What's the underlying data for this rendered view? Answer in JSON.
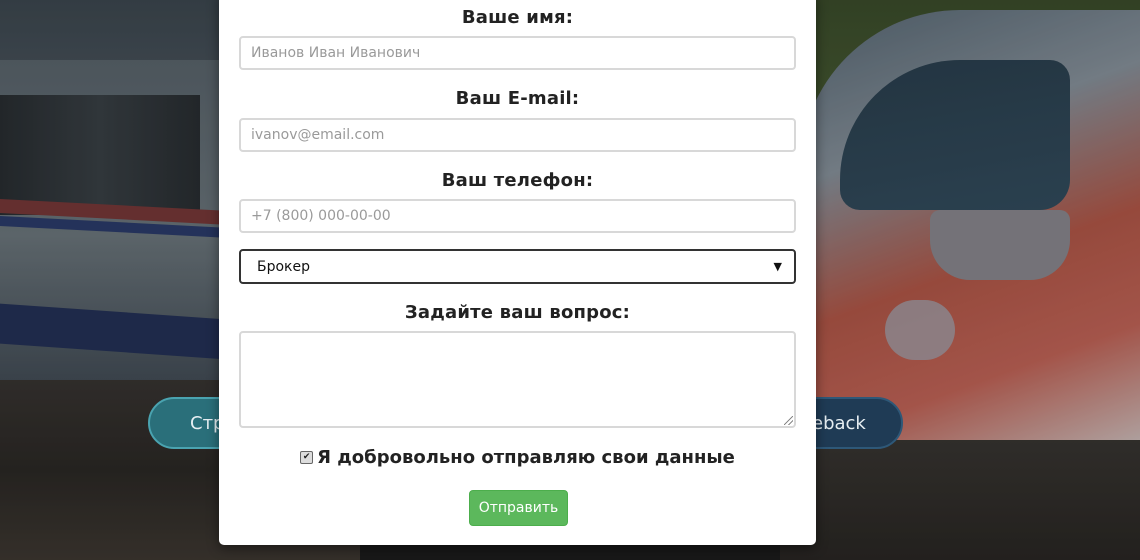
{
  "background": {
    "left_button_label": "Стр",
    "right_button_label": "eback"
  },
  "form": {
    "name_label": "Ваше имя:",
    "name_placeholder": "Иванов Иван Иванович",
    "email_label": "Ваш E-mail:",
    "email_placeholder": "ivanov@email.com",
    "phone_label": "Ваш телефон:",
    "phone_placeholder": "+7 (800) 000-00-00",
    "role_select_value": "Брокер",
    "question_label": "Задайте ваш вопрос:",
    "question_value": "",
    "consent_checked": true,
    "consent_label": "Я добровольно отправляю свои данные",
    "submit_label": "Отправить"
  },
  "colors": {
    "submit_button": "#5cb85c",
    "modal_background": "#ffffff"
  }
}
